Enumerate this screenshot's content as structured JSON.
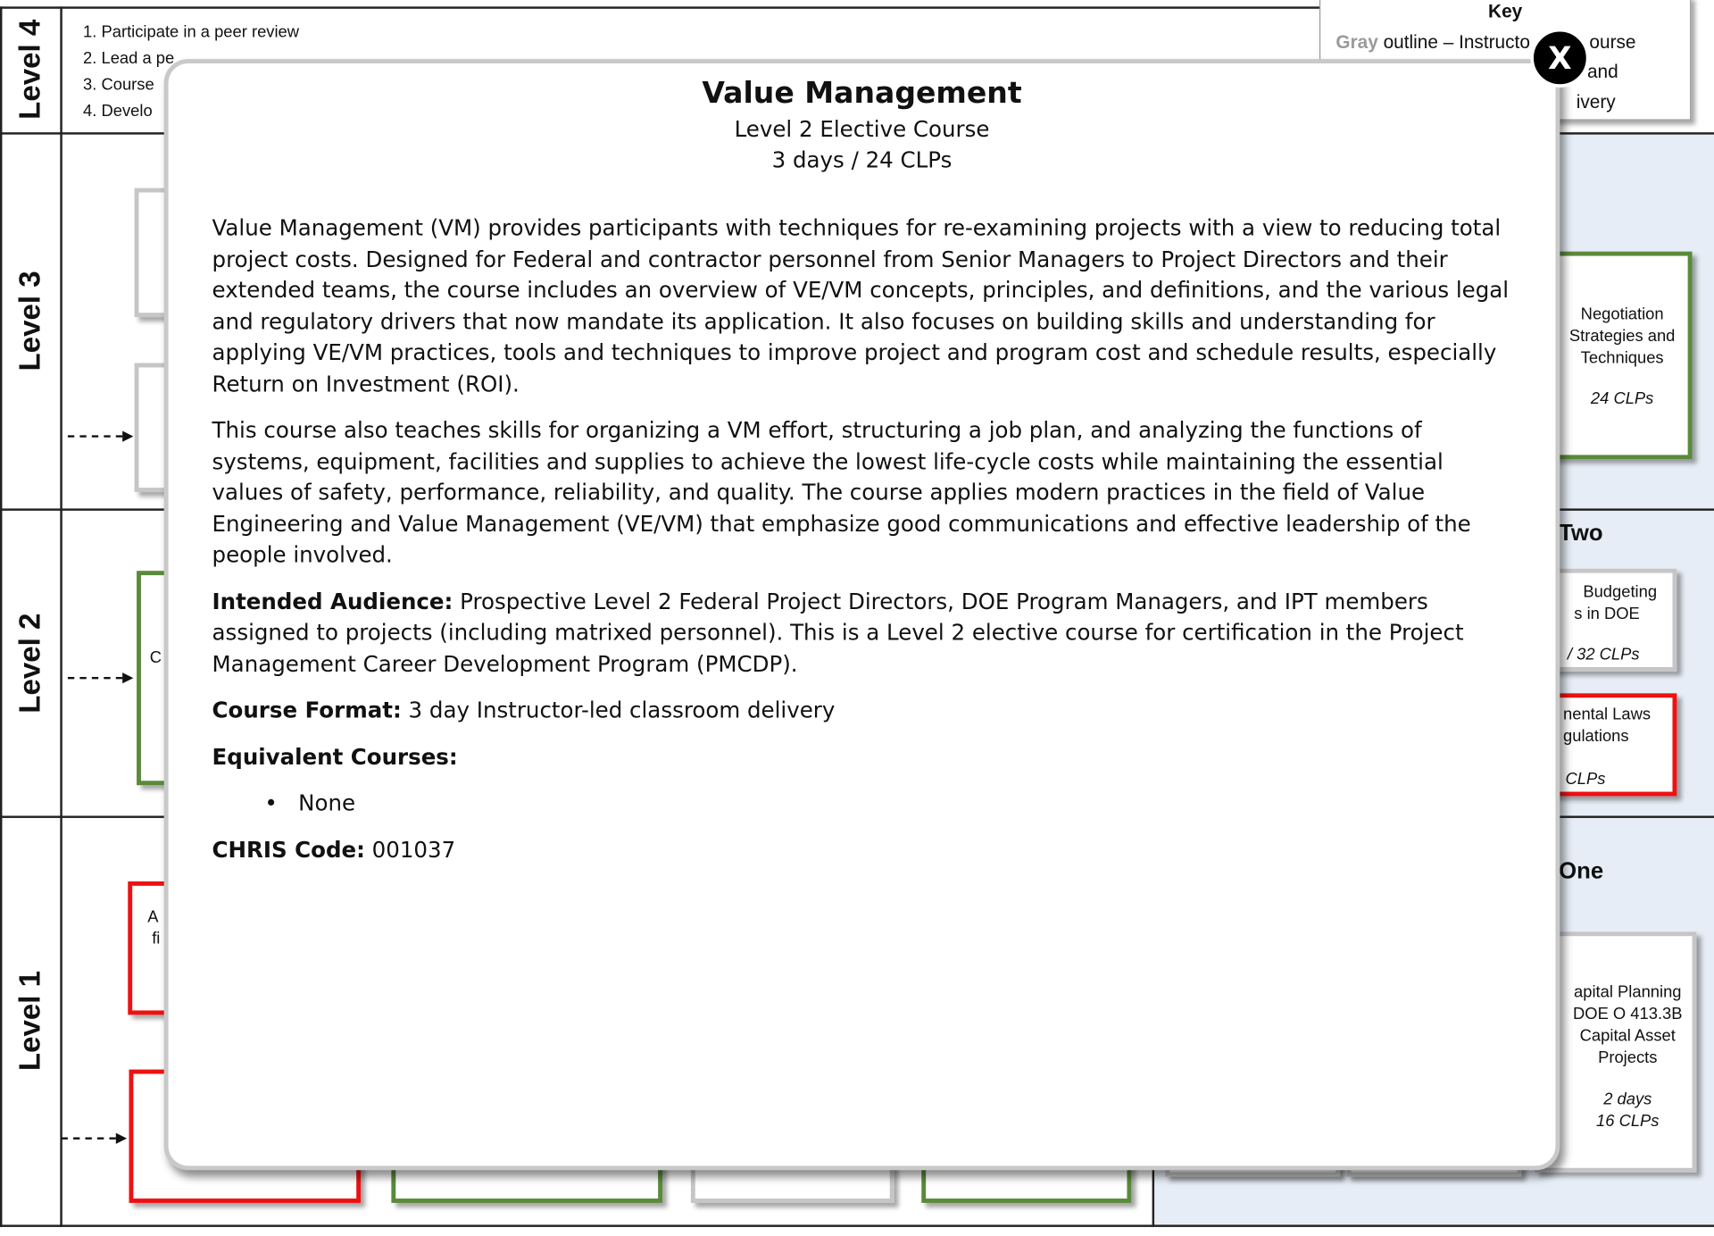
{
  "levels": [
    "Level 4",
    "Level 3",
    "Level 2",
    "Level 1"
  ],
  "level4_list": [
    "1. Participate in a peer review",
    "2. Lead a pe",
    "3. Course",
    "4. Develo"
  ],
  "key": {
    "title": "Key",
    "gray_word": "Gray",
    "line1_rest": "outline – Instructo",
    "line1_tail": "ourse",
    "line2_tail": "and",
    "line3_tail": "ivery"
  },
  "sections": {
    "two": "Two",
    "one": "One"
  },
  "background_boxes": {
    "negotiation": {
      "title_lines": [
        "Negotiation",
        "Strategies and",
        "Techniques"
      ],
      "clps": "24 CLPs"
    },
    "budgeting": {
      "title_lines": [
        "Budgeting",
        "s in DOE"
      ],
      "clps": "/ 32 CLPs"
    },
    "environmental": {
      "title_lines": [
        "nental Laws",
        "gulations"
      ],
      "clps": "CLPs"
    },
    "capital": {
      "title_lines": [
        "apital Planning",
        "DOE O 413.3B",
        "Capital Asset",
        "Projects"
      ],
      "days": "2 days",
      "clps": "16 CLPs"
    },
    "level2_left_letter": "C",
    "level1_left_letters": [
      "A",
      "fi"
    ]
  },
  "modal": {
    "title": "Value Management",
    "subtitle": "Level 2 Elective Course",
    "duration": "3 days / 24 CLPs",
    "paragraph1": "Value Management (VM) provides participants with techniques for re-examining projects with a view to reducing total project costs. Designed for Federal and contractor personnel from Senior Managers to Project Directors and their extended teams, the course includes an overview of VE/VM concepts, principles, and definitions, and the various legal and regulatory drivers that now mandate its application. It also focuses on building skills and understanding for applying VE/VM practices, tools and techniques to improve project and program cost and schedule results, especially Return on Investment (ROI).",
    "paragraph2": "This course also teaches skills for organizing a VM effort, structuring a job plan, and analyzing the functions of systems, equipment, facilities and supplies to achieve the lowest life-cycle costs while maintaining the essential values of safety, performance, reliability, and quality. The course applies modern practices in the field of Value Engineering and Value Management (VE/VM) that emphasize good communications and effective leadership of the people involved.",
    "audience_label": "Intended Audience:",
    "audience_text": " Prospective Level 2 Federal Project Directors, DOE Program Managers, and IPT members assigned to projects (including matrixed personnel). This is a Level 2 elective course for certification in the Project Management Career Development Program (PMCDP).",
    "format_label": "Course Format:",
    "format_text": " 3 day Instructor-led classroom delivery",
    "equivalent_label": "Equivalent Courses:",
    "equivalent_items": [
      "None"
    ],
    "chris_label": "CHRIS Code:",
    "chris_code": " 001037",
    "close_label": "X"
  }
}
